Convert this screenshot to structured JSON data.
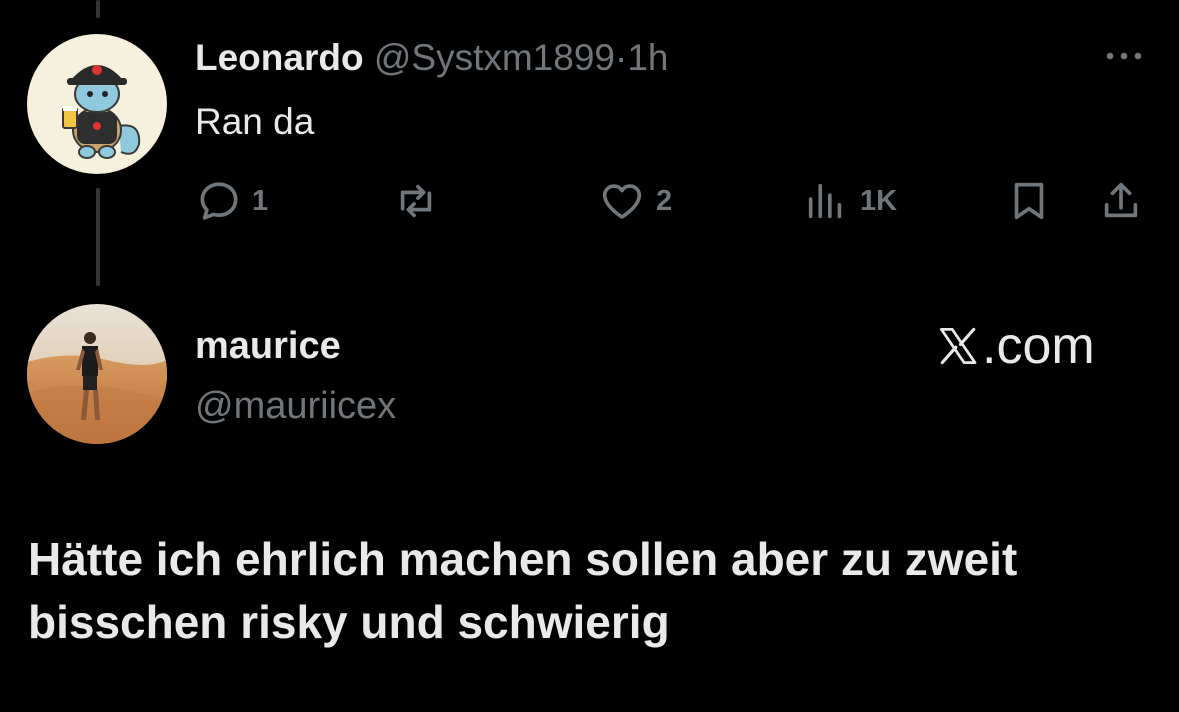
{
  "tweet1": {
    "display_name": "Leonardo",
    "handle": "@Systxm1899",
    "separator": "·",
    "time": "1h",
    "text": "Ran da",
    "actions": {
      "reply_count": "1",
      "retweet_count": "",
      "like_count": "2",
      "view_count": "1K"
    }
  },
  "tweet2": {
    "display_name": "maurice",
    "handle": "@mauriicex",
    "text": "Hätte ich ehrlich machen sollen aber zu zweit bisschen risky und schwierig"
  },
  "watermark": {
    "text": ".com"
  },
  "icons": {
    "more": "more-horizontal-icon",
    "reply": "reply-icon",
    "retweet": "retweet-icon",
    "like": "heart-icon",
    "views": "views-icon",
    "bookmark": "bookmark-icon",
    "share": "share-icon",
    "x_logo": "x-logo-icon"
  },
  "colors": {
    "background": "#000000",
    "primary_text": "#e7e9ea",
    "secondary_text": "#71767b",
    "thread_line": "#333639"
  }
}
